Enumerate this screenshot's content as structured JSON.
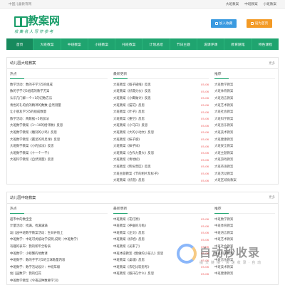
{
  "topbar": {
    "greeting": "中国儿童教育网",
    "links": [
      "大班教案",
      "中班教案",
      "小班教案"
    ]
  },
  "header": {
    "logo_text": "教案网",
    "slogan": "收集名人写作参考",
    "btn_favorite": "加入收藏",
    "btn_home": "设为首页"
  },
  "nav": [
    "首页",
    "大班教案",
    "中班教案",
    "小班教案",
    "托班教案",
    "计划总结",
    "节日主题",
    "说课评课",
    "教育随笔",
    "特色课程"
  ],
  "section1": {
    "title": "幼儿园大班教案",
    "more": "更多",
    "col1_head": "热点",
    "col2_head": "最新更新",
    "col3_head": "推荐",
    "col1": [
      "数学活动：数的子学习5的组成",
      "数的子学习5组成的教学方案",
      "认识几门解一个+1的记数方法",
      "青色的礼的奶的精神的数数 自然测量",
      "让小朋友学习5的组成数量",
      "数学活动：两数据+5的加法",
      "大班数学教案《1～10的相邻数》反思",
      "大班数学教案《雕刻的小鸡》反思",
      "大班数学教案《赢足的鸡足球》反思",
      "大班数学教案《小的加法》反思",
      "大班数学教案《十一个一千》",
      "大班科学教案《自然测量》反思"
    ],
    "col2": [
      {
        "t": "大班教案《猴子捕线》反思",
        "d": "05-06"
      },
      {
        "t": "大班教案《好漏分伙》反思",
        "d": "05-06"
      },
      {
        "t": "大班教案《小鹰做计》反思",
        "d": "05-06"
      },
      {
        "t": "大班教案《猫花》反思",
        "d": "05-06"
      },
      {
        "t": "大班教案《叶子》反思",
        "d": "05-06"
      },
      {
        "t": "大班教案《重空》反思",
        "d": "05-06"
      },
      {
        "t": "大班教案《小马口》反思",
        "d": "05-06"
      },
      {
        "t": "大班教案《大的小动文》反思",
        "d": "05-06"
      },
      {
        "t": "大班教案《妹子感》",
        "d": "05-06"
      },
      {
        "t": "大班教案《妹子体》",
        "d": "05-06"
      },
      {
        "t": "大班教案《合作力量大》反思",
        "d": "05-06"
      },
      {
        "t": "大班教案《青地机》",
        "d": "05-06"
      },
      {
        "t": "大班教案《熊份营区》反思",
        "d": "05-06"
      },
      {
        "t": "大班主题教案《节的相片及标子》",
        "d": "05-06"
      },
      {
        "t": "大班教案《好逛》反思",
        "d": "05-06"
      }
    ],
    "col3": [
      "大班数学教案",
      "大班体育教案",
      "大班语言教案",
      "大班艺术教案",
      "大班社会教案",
      "大班科学教案",
      "大班音乐教案",
      "大班美术教案",
      "大班健康教案",
      "大班安全教案",
      "大班主题教案",
      "大班游戏教案",
      "大班英语教案",
      "大班活动教案",
      "大班区域角教案"
    ]
  },
  "section2": {
    "title": "幼儿园中班教案",
    "more": "更多",
    "col1_head": "热点",
    "col2_head": "最新更新",
    "col3_head": "推荐",
    "col1": [
      "超市中的数宝宝",
      "计量活动：找满，找满满满",
      "幼儿园中班数学教案活动：生日开始上",
      "中班数学：中班可式纸动学说明,说明（中班数学）",
      "有趣的表布：我的新年全粉表",
      "中班数学：小螃蟹的地数课",
      "中班数学：数的子学习5的全球数量内容",
      "中班数学：数学活动设计：中班年级",
      "幼儿园数学：我的红花",
      "中班数学教案《今夜这种数要学习》"
    ],
    "col2": [
      {
        "t": "中班教案《花灯原》",
        "d": "05-06"
      },
      {
        "t": "中班教案《养蚕的乌龟》",
        "d": "05-06"
      },
      {
        "t": "中班教案《正文》反思",
        "d": "05-06"
      },
      {
        "t": "中班教案《好哈》反思",
        "d": "05-06"
      },
      {
        "t": "中班教案《光束了》",
        "d": "05-06"
      },
      {
        "t": "中班体操教案《集做的小孩儿》反思",
        "d": "05-06"
      },
      {
        "t": "中班教案《桌魂》反思",
        "d": "05-06"
      },
      {
        "t": "中班教案《去吃比较思考》",
        "d": "05-06"
      },
      {
        "t": "中班教案《猴开在什么》反思",
        "d": "05-06"
      }
    ],
    "col3": [
      "中班数学教案",
      "中班体育教案",
      "中班语言教案",
      "中班艺术教案",
      "中班社会教案",
      "中班科学教案",
      "中班音乐教案",
      "中班美术教案",
      "中班健康教案"
    ]
  },
  "watermark": {
    "big": "自动秒收录",
    "small": "提交链接·快速收录·自动"
  }
}
